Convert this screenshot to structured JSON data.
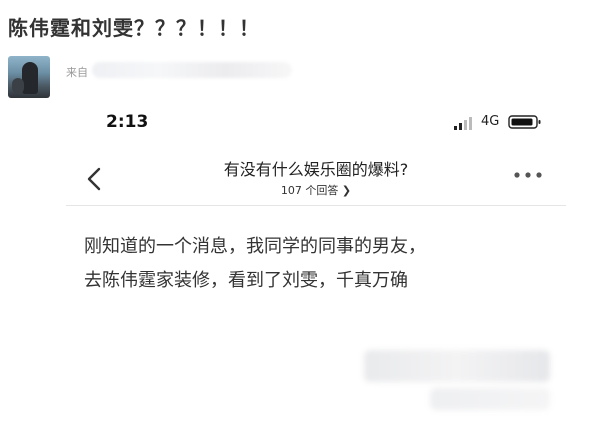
{
  "post": {
    "title": "陈伟霆和刘雯？？？！！！",
    "from_label": "来自"
  },
  "status_bar": {
    "time": "2:13",
    "network": "4G"
  },
  "question": {
    "title": "有没有什么娱乐圈的爆料?",
    "answers": "107 个回答",
    "answers_chevron": "❯"
  },
  "answer": {
    "line1": "刚知道的一个消息，我同学的同事的男友，",
    "line2": "去陈伟霆家装修，看到了刘雯，千真万确"
  },
  "icons": {
    "back": "chevron-left-icon",
    "more": "more-dots-icon",
    "signal": "signal-icon",
    "battery": "battery-icon"
  }
}
